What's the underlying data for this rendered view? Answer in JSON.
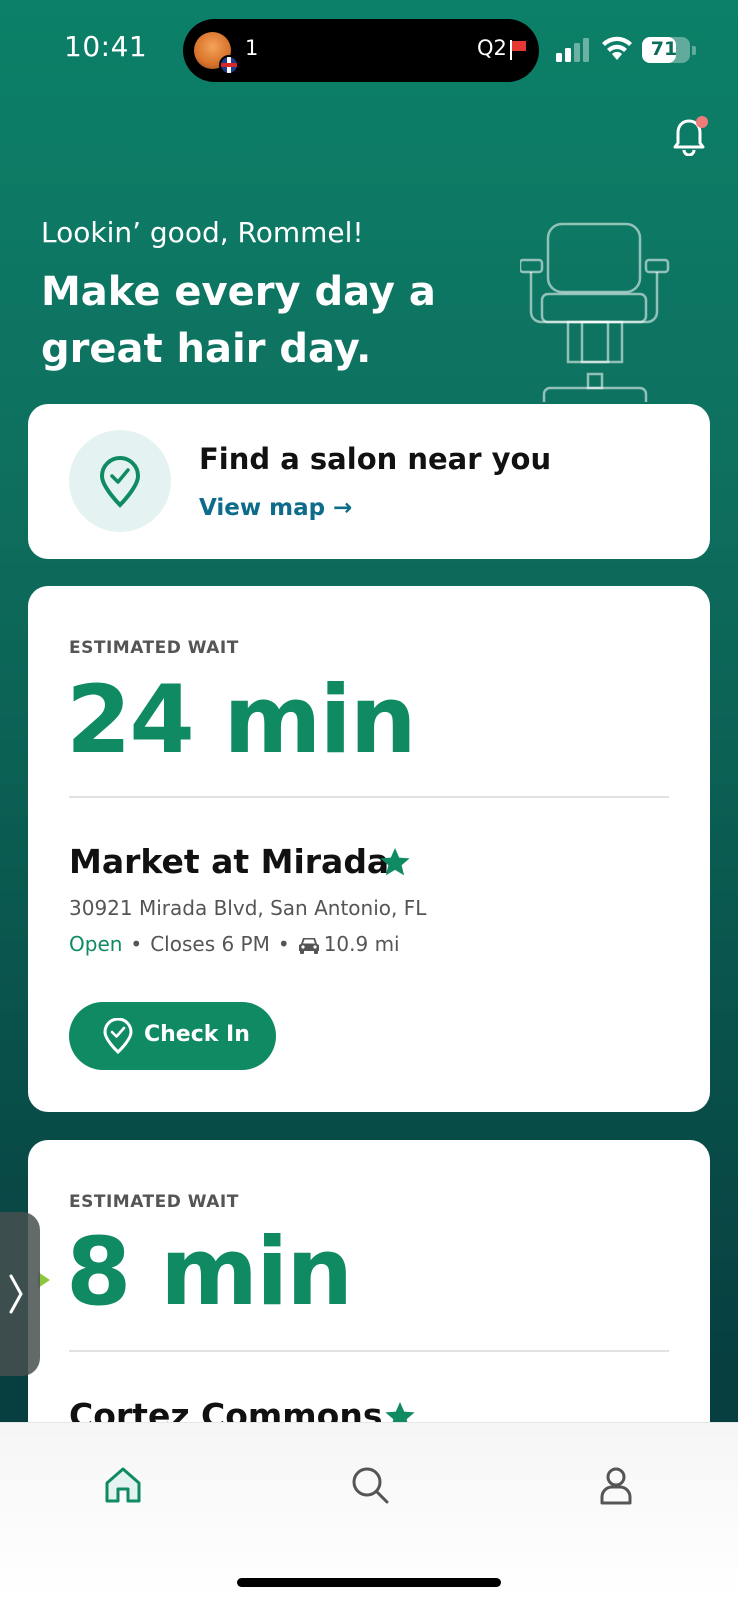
{
  "status_bar": {
    "time": "10:41",
    "island_count": "1",
    "island_q": "Q2",
    "battery": "71",
    "battery_level": 0.71
  },
  "header": {
    "greeting": "Lookin’ good, Rommel!",
    "headline": "Make every day a great hair day.",
    "notification_dot_color": "#f07b7b"
  },
  "salon_finder": {
    "title": "Find a salon near you",
    "link": "View map →"
  },
  "wait_cards": [
    {
      "label": "ESTIMATED WAIT",
      "wait": "24 min",
      "name": "Market at Mirada",
      "address": "30921 Mirada Blvd, San Antonio, FL",
      "status": "Open",
      "closes": "Closes 6 PM",
      "distance": "10.9 mi",
      "button": "Check In"
    },
    {
      "label": "ESTIMATED WAIT",
      "wait": "8 min",
      "name": "Cortez Commons"
    }
  ],
  "bottom_nav": {
    "items": [
      "home-icon",
      "search-icon",
      "profile-icon"
    ],
    "active": "home-icon"
  },
  "colors": {
    "brand_green": "#0f8a63",
    "link_blue": "#0c6c8a"
  }
}
